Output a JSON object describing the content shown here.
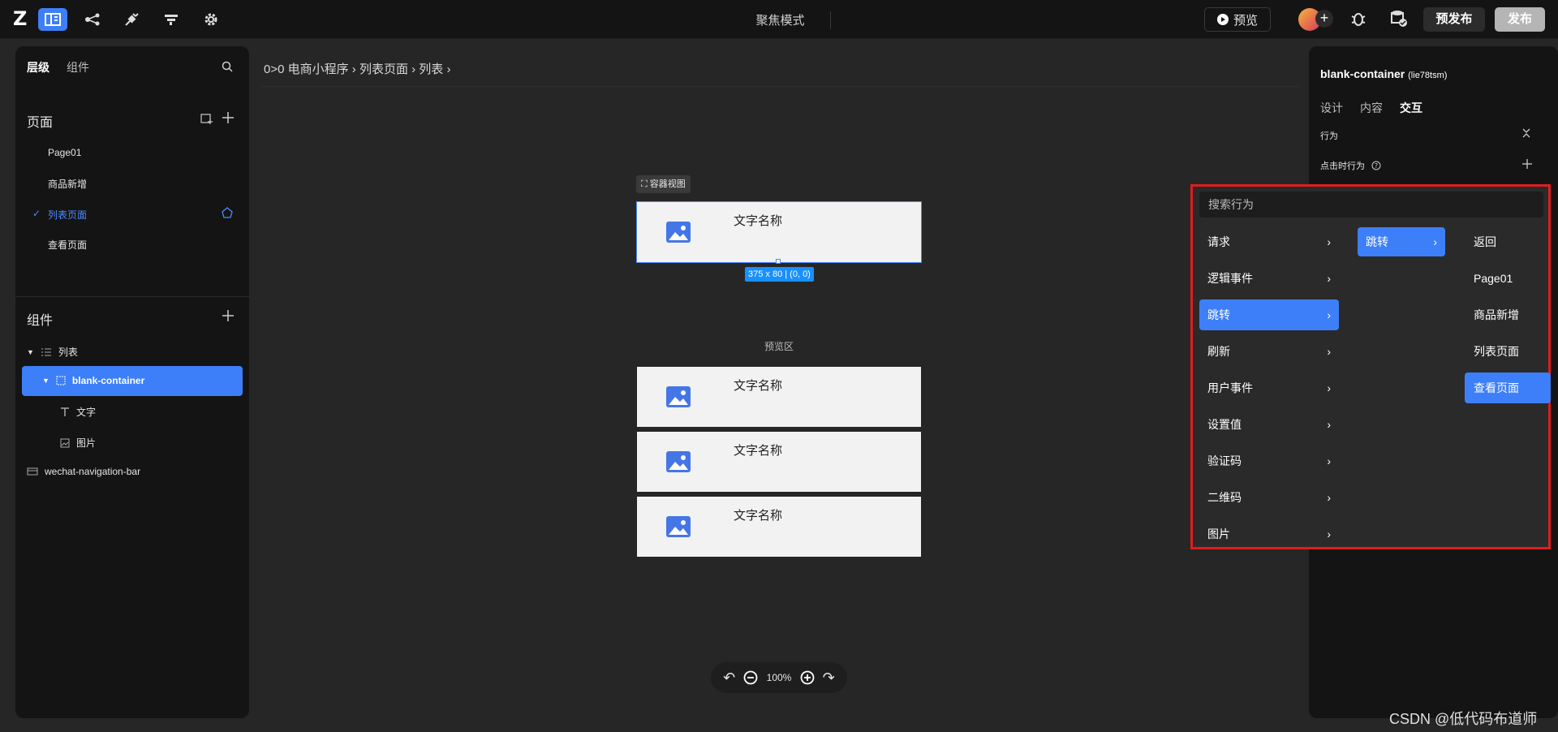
{
  "topbar": {
    "focus_mode": "聚焦模式",
    "preview_label": "预览",
    "pre_publish_label": "预发布",
    "publish_label": "发布"
  },
  "left_panel": {
    "tabs": [
      "层级",
      "组件"
    ],
    "pages_title": "页面",
    "pages": [
      {
        "label": "Page01",
        "selected": false
      },
      {
        "label": "商品新增",
        "selected": false
      },
      {
        "label": "列表页面",
        "selected": true
      },
      {
        "label": "查看页面",
        "selected": false
      }
    ],
    "components_title": "组件",
    "tree": [
      {
        "label": "列表",
        "icon": "list-icon"
      },
      {
        "label": "blank-container",
        "icon": "container-icon",
        "selected": true
      },
      {
        "label": "文字",
        "icon": "text-icon"
      },
      {
        "label": "图片",
        "icon": "image-icon"
      },
      {
        "label": "wechat-navigation-bar",
        "icon": "navbar-icon"
      }
    ]
  },
  "breadcrumb": "0>0  电商小程序 › 列表页面 › 列表 ›",
  "canvas": {
    "container_tag": "容器视图",
    "size_badge": "375 x 80 | (0, 0)",
    "preview_area": "预览区",
    "card_text": "文字名称",
    "zoom": "100%"
  },
  "right_panel": {
    "title": "blank-container",
    "title_id": "(lie78tsm)",
    "tabs": [
      "设计",
      "内容",
      "交互"
    ],
    "behavior_label": "行为",
    "on_click_label": "点击时行为"
  },
  "dropdown": {
    "search_placeholder": "搜索行为",
    "categories": [
      {
        "label": "请求",
        "active": false
      },
      {
        "label": "逻辑事件",
        "active": false
      },
      {
        "label": "跳转",
        "active": true
      },
      {
        "label": "刷新",
        "active": false
      },
      {
        "label": "用户事件",
        "active": false
      },
      {
        "label": "设置值",
        "active": false
      },
      {
        "label": "验证码",
        "active": false
      },
      {
        "label": "二维码",
        "active": false
      },
      {
        "label": "图片",
        "active": false
      }
    ],
    "sub_item": "跳转",
    "targets": [
      {
        "label": "返回",
        "active": false
      },
      {
        "label": "Page01",
        "active": false
      },
      {
        "label": "商品新增",
        "active": false
      },
      {
        "label": "列表页面",
        "active": false
      },
      {
        "label": "查看页面",
        "active": true
      }
    ]
  },
  "watermark": "CSDN @低代码布道师",
  "colors": {
    "accent": "#3d7ff8",
    "highlight_border": "#e11d1d"
  }
}
